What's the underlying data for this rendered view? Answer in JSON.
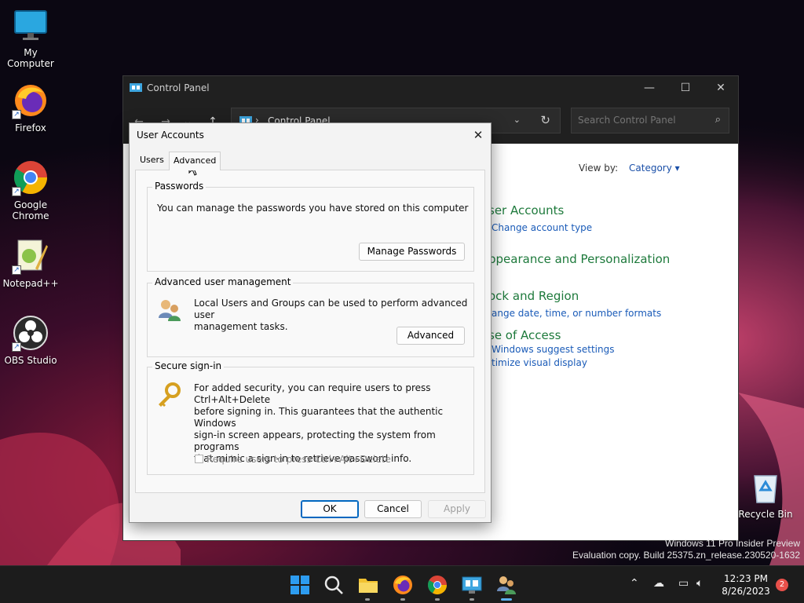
{
  "desktop": {
    "icons": [
      {
        "label": "My Computer",
        "icon": "monitor-icon"
      },
      {
        "label": "Firefox",
        "icon": "firefox-icon"
      },
      {
        "label": "Google Chrome",
        "icon": "chrome-icon"
      },
      {
        "label": "Notepad++",
        "icon": "notepadpp-icon"
      },
      {
        "label": "OBS Studio",
        "icon": "obs-icon"
      },
      {
        "label": "Recycle Bin",
        "icon": "recycle-bin-icon"
      }
    ],
    "watermark": {
      "line1": "Windows 11 Pro Insider Preview",
      "line2": "Evaluation copy. Build 25375.zn_release.230520-1632"
    }
  },
  "control_panel": {
    "title": "Control Panel",
    "address": "Control Panel",
    "search_placeholder": "Search Control Panel",
    "view_by_label": "View by:",
    "view_by_value": "Category",
    "categories": [
      {
        "title": "ser Accounts",
        "links": [
          "Change account type"
        ]
      },
      {
        "title": "ppearance and Personalization",
        "links": []
      },
      {
        "title": "ock and Region",
        "links": [
          "ange date, time, or number formats"
        ]
      },
      {
        "title": "se of Access",
        "links": [
          "Windows suggest settings",
          "timize visual display"
        ]
      }
    ]
  },
  "dialog": {
    "title": "User Accounts",
    "tabs": [
      "Users",
      "Advanced"
    ],
    "active_tab": "Advanced",
    "passwords": {
      "label": "Passwords",
      "text": "You can manage the passwords you have stored on this computer",
      "button": "Manage Passwords"
    },
    "advanced_mgmt": {
      "label": "Advanced user management",
      "text_line1": "Local Users and Groups can be used to perform advanced user",
      "text_line2": "management tasks.",
      "button": "Advanced"
    },
    "secure_signin": {
      "label": "Secure sign-in",
      "text_line1": "For added security, you can require users to press Ctrl+Alt+Delete",
      "text_line2": "before signing in. This guarantees that the authentic Windows",
      "text_line3": "sign-in screen appears, protecting the system from programs",
      "text_line4": "that mimic a sign-in to retrieve password info.",
      "checkbox_label": "Require users to press Ctrl+Alt+Delete",
      "checkbox_checked": false
    },
    "buttons": {
      "ok": "OK",
      "cancel": "Cancel",
      "apply": "Apply"
    }
  },
  "taskbar": {
    "time": "12:23 PM",
    "date": "8/26/2023",
    "notifications": "2"
  }
}
